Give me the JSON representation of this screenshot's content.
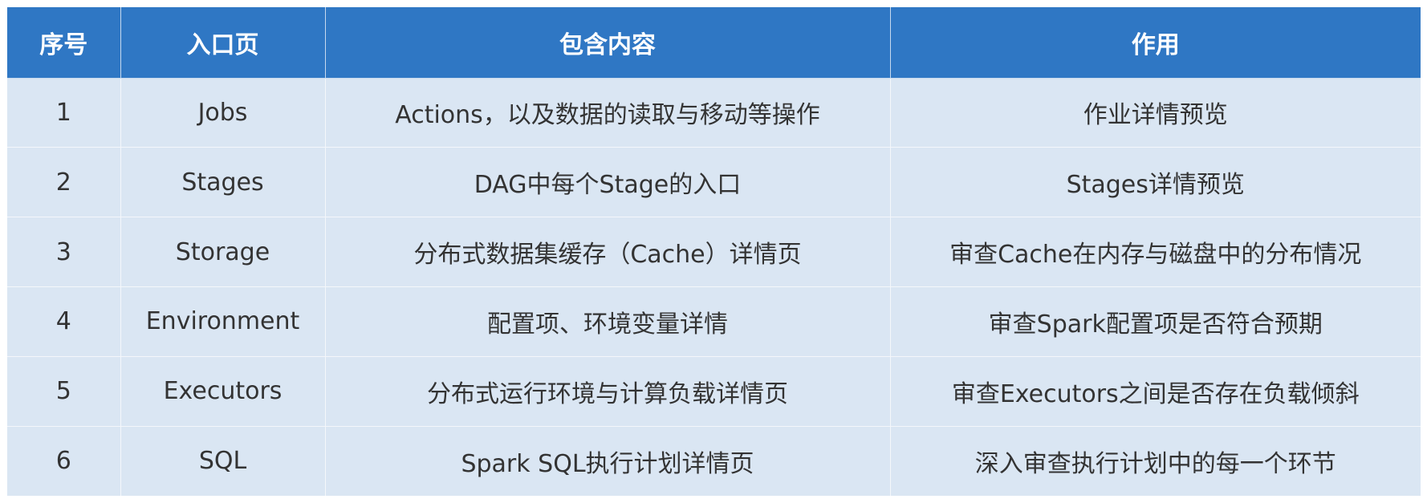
{
  "table": {
    "headers": [
      "序号",
      "入口页",
      "包含内容",
      "作用"
    ],
    "rows": [
      {
        "index": "1",
        "entry": "Jobs",
        "content": "Actions，以及数据的读取与移动等操作",
        "purpose": "作业详情预览"
      },
      {
        "index": "2",
        "entry": "Stages",
        "content": "DAG中每个Stage的入口",
        "purpose": "Stages详情预览"
      },
      {
        "index": "3",
        "entry": "Storage",
        "content": "分布式数据集缓存（Cache）详情页",
        "purpose": "审查Cache在内存与磁盘中的分布情况"
      },
      {
        "index": "4",
        "entry": "Environment",
        "content": "配置项、环境变量详情",
        "purpose": "审查Spark配置项是否符合预期"
      },
      {
        "index": "5",
        "entry": "Executors",
        "content": "分布式运行环境与计算负载详情页",
        "purpose": "审查Executors之间是否存在负载倾斜"
      },
      {
        "index": "6",
        "entry": "SQL",
        "content": "Spark SQL执行计划详情页",
        "purpose": "深入审查执行计划中的每一个环节"
      }
    ]
  },
  "colors": {
    "header_bg": "#2f77c4",
    "header_text": "#ffffff",
    "row_bg": "#dae6f3",
    "row_text": "#333333"
  }
}
